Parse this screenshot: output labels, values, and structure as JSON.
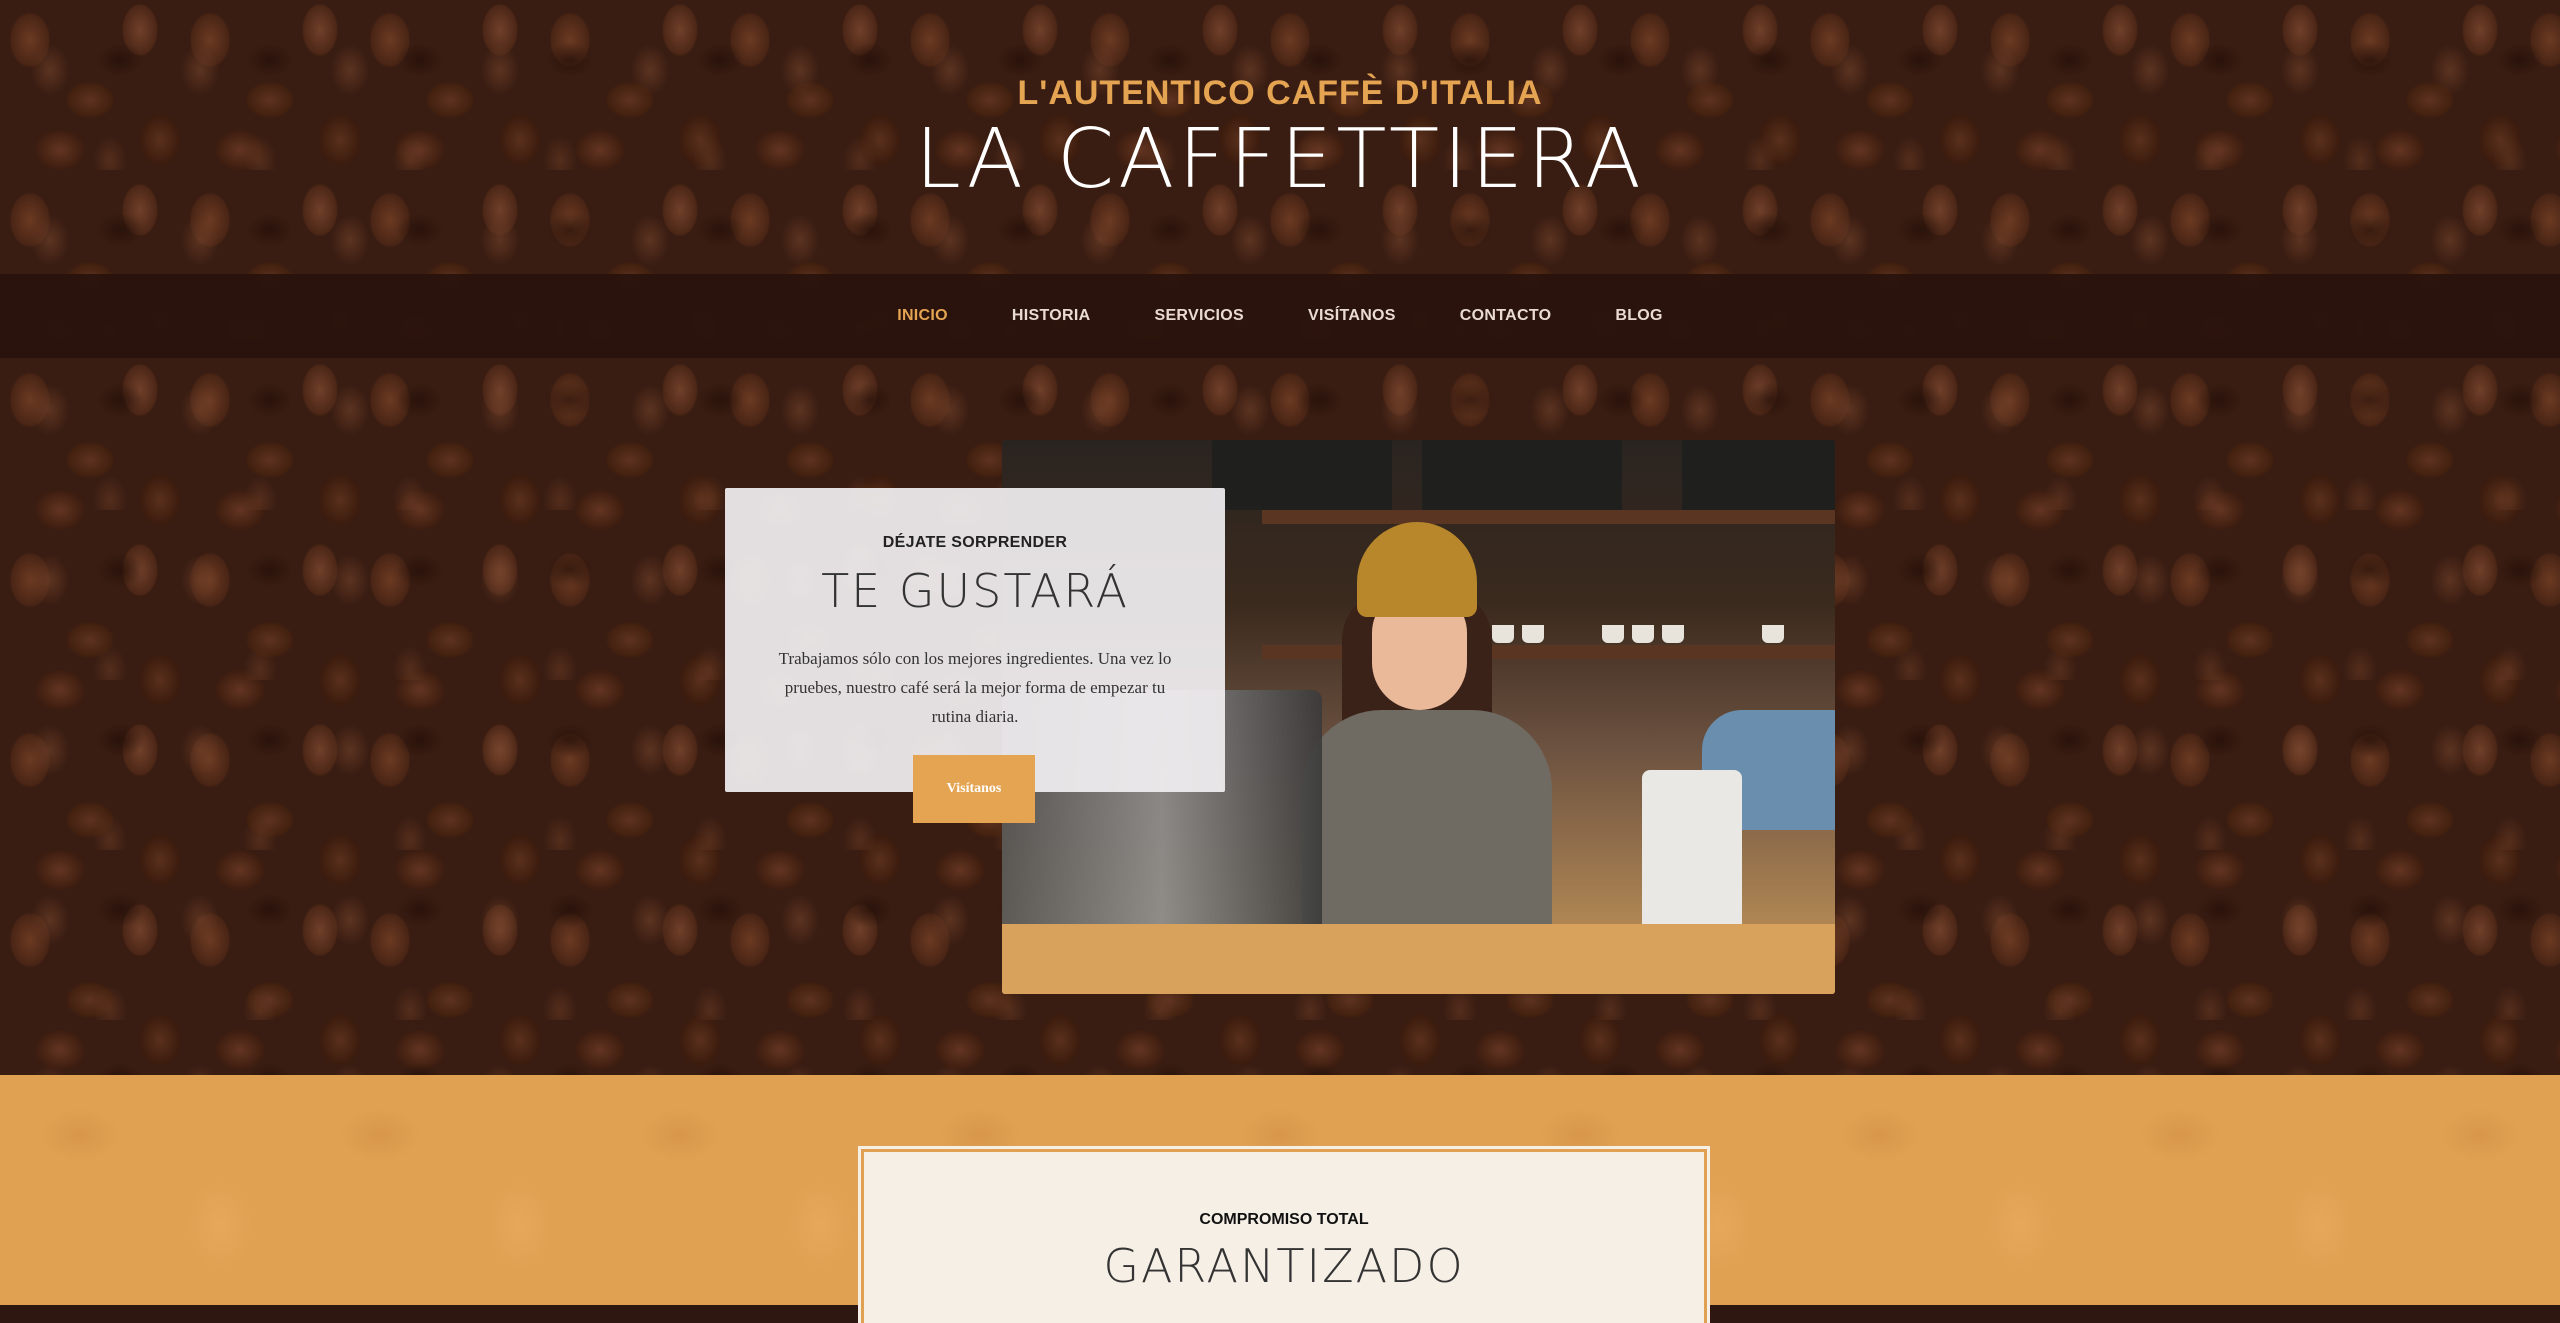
{
  "header": {
    "tagline": "L'AUTENTICO CAFFÈ D'ITALIA",
    "brand": "LA CAFFETTIERA"
  },
  "nav": {
    "items": [
      {
        "label": "INICIO",
        "active": true
      },
      {
        "label": "HISTORIA",
        "active": false
      },
      {
        "label": "SERVICIOS",
        "active": false
      },
      {
        "label": "VISÍTANOS",
        "active": false
      },
      {
        "label": "CONTACTO",
        "active": false
      },
      {
        "label": "BLOG",
        "active": false
      }
    ]
  },
  "hero": {
    "eyebrow": "DÉJATE SORPRENDER",
    "title": "TE GUSTARÁ",
    "body": "Trabajamos sólo con los mejores ingredientes. Una vez lo pruebes, nuestro café será la mejor forma de empezar tu rutina diaria.",
    "cta_label": "Visítanos"
  },
  "promise": {
    "eyebrow": "COMPROMISO TOTAL",
    "title": "GARANTIZADO"
  },
  "colors": {
    "accent": "#e5a452",
    "nav_bg": "#28120c",
    "section_bg": "#e0a152"
  }
}
